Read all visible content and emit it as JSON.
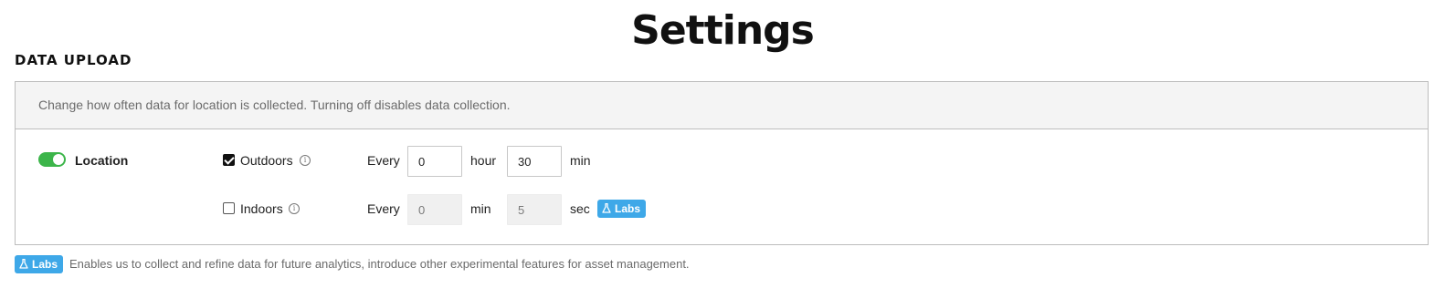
{
  "page": {
    "title": "Settings"
  },
  "section": {
    "title": "DATA UPLOAD"
  },
  "card": {
    "description": "Change how often data for location is collected. Turning off disables data collection.",
    "location": {
      "label": "Location",
      "enabled": true
    },
    "outdoors": {
      "label": "Outdoors",
      "checked": true,
      "every_label": "Every",
      "value1": "0",
      "unit1": "hour",
      "value2": "30",
      "unit2": "min"
    },
    "indoors": {
      "label": "Indoors",
      "checked": false,
      "every_label": "Every",
      "value1": "0",
      "unit1": "min",
      "value2": "5",
      "unit2": "sec",
      "badge": "Labs"
    }
  },
  "footer": {
    "badge": "Labs",
    "text": "Enables us to collect and refine data for future analytics, introduce other experimental features for asset management."
  },
  "colors": {
    "toggle_on": "#3cb54a",
    "labs_badge": "#3ea8e8"
  },
  "icons": [
    "info-icon",
    "flask-icon"
  ]
}
